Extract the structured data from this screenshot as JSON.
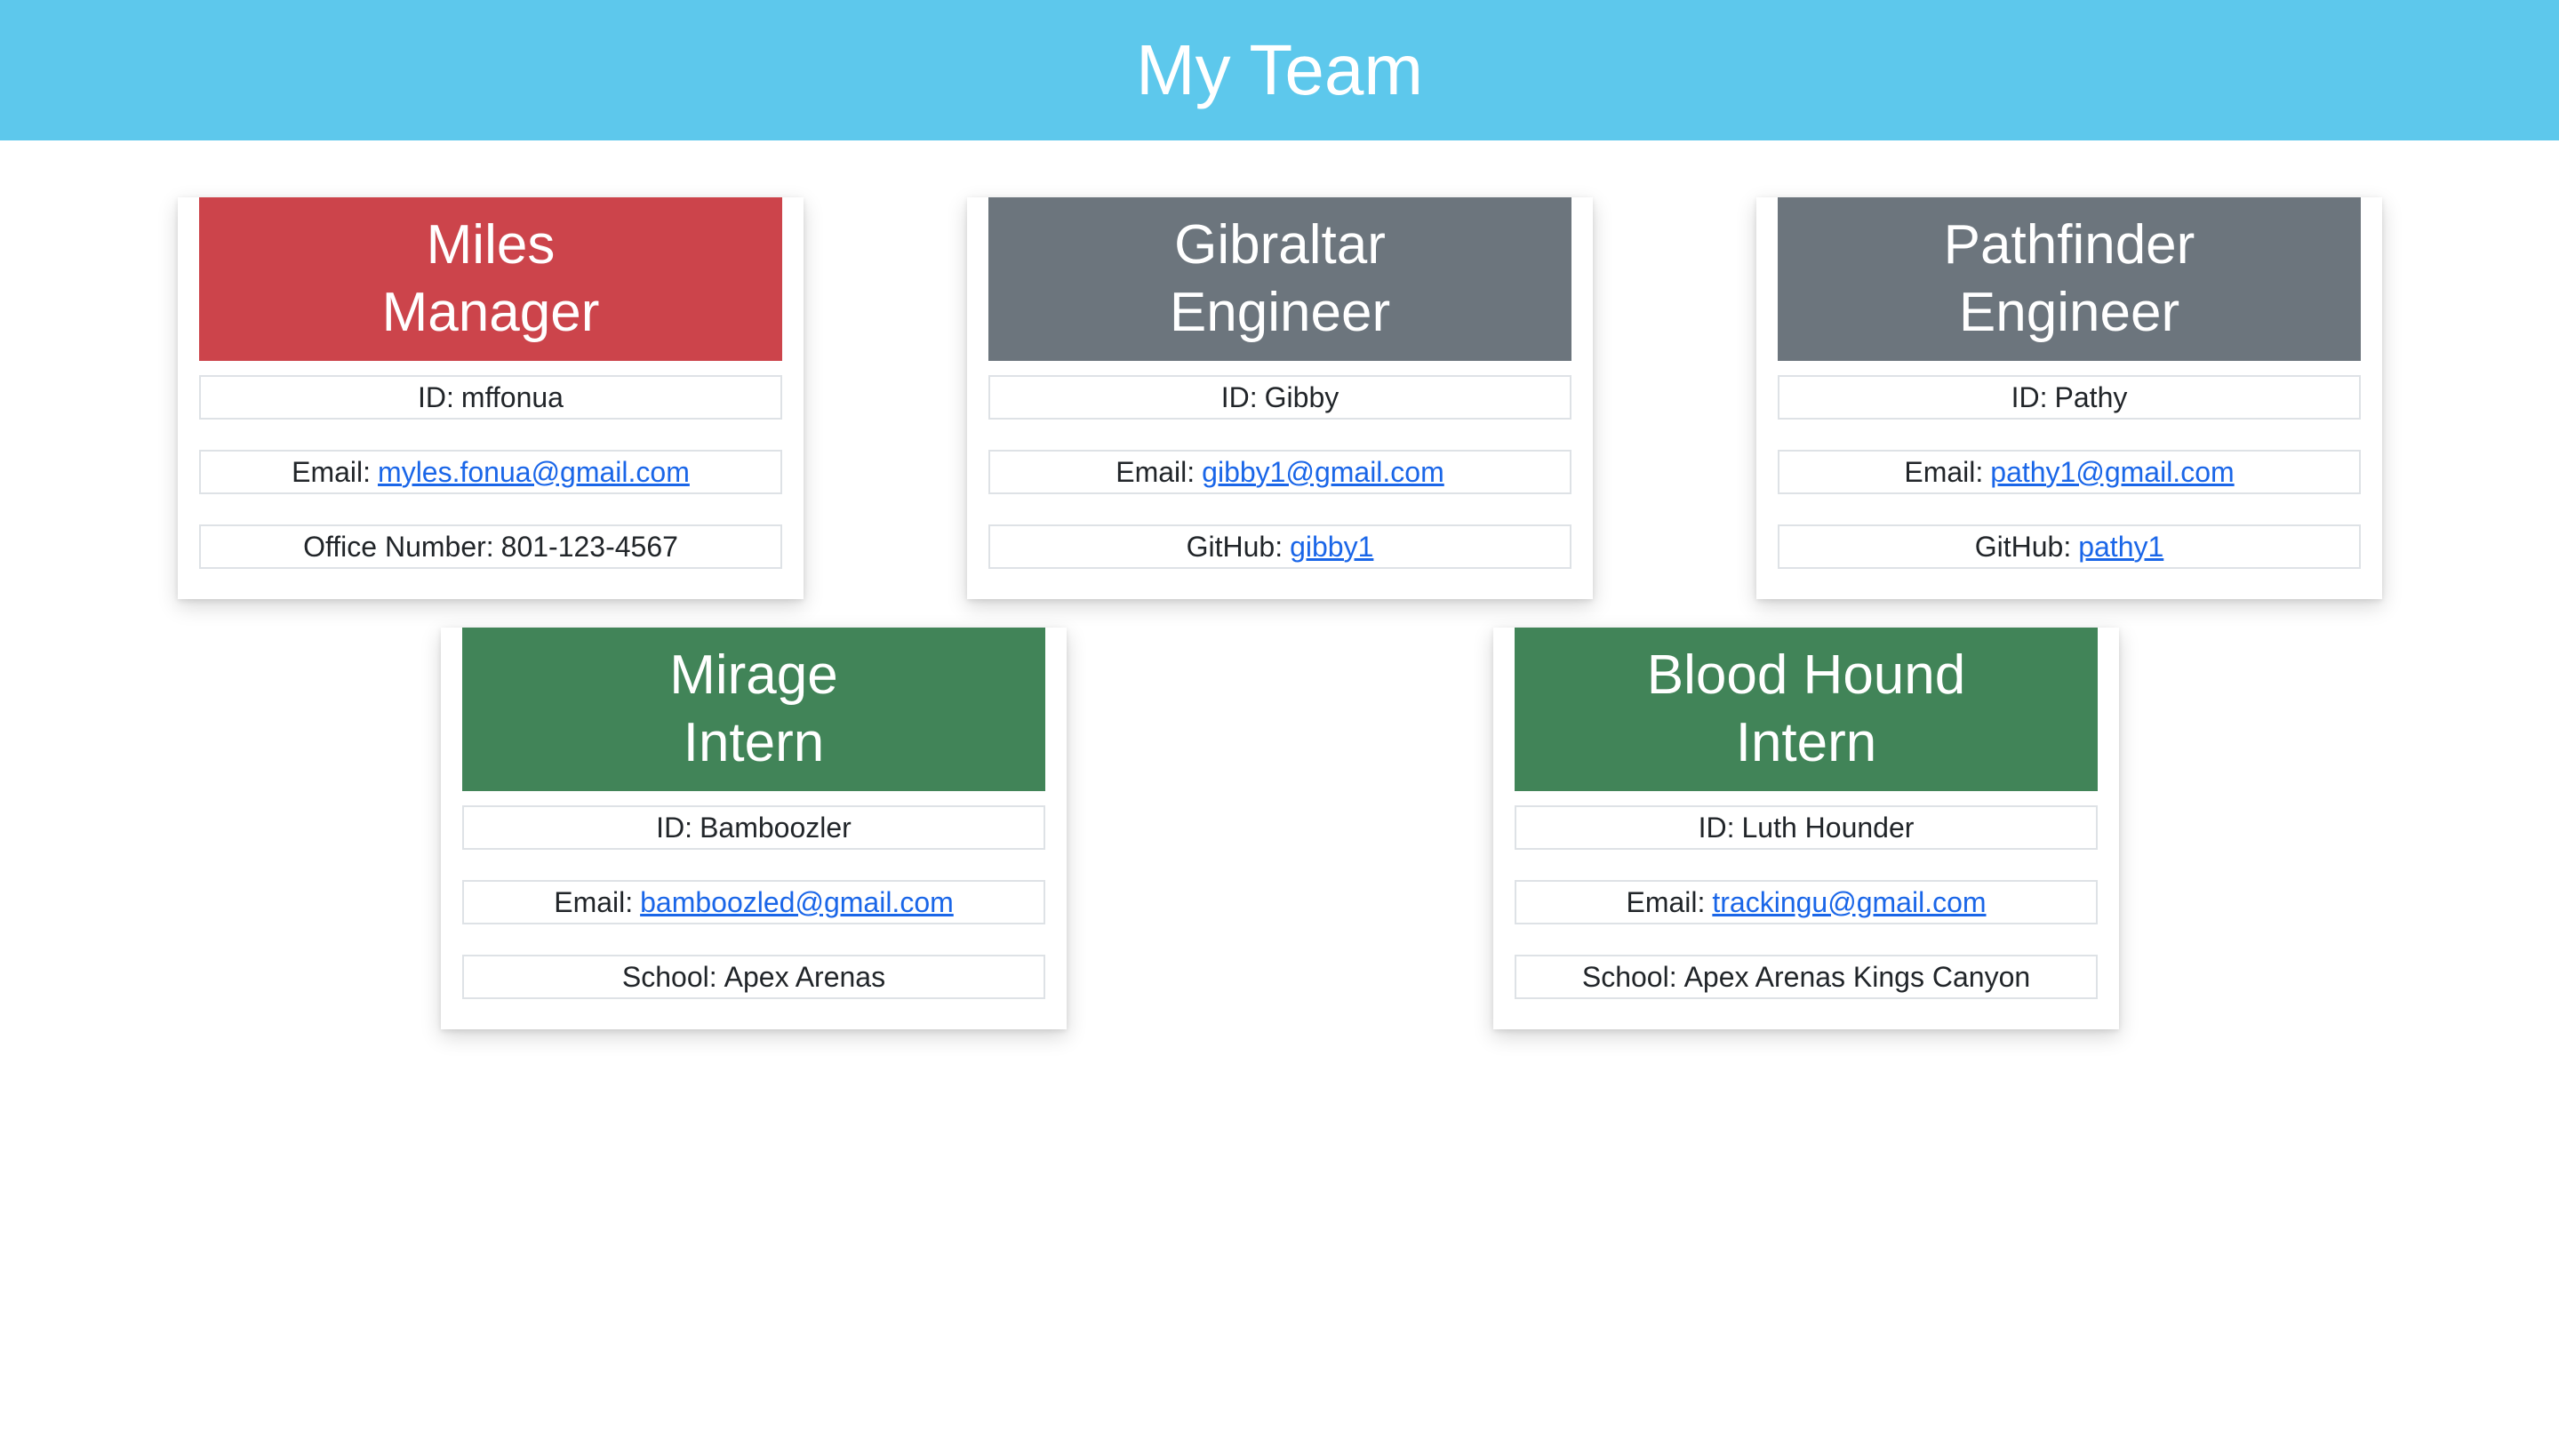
{
  "header": {
    "title": "My Team"
  },
  "colors": {
    "header_bg": "#5dc8ec",
    "manager": "#cc444b",
    "engineer": "#6c757d",
    "intern": "#418458",
    "link": "#1a66e8"
  },
  "cards": [
    {
      "name": "Miles",
      "role": "Manager",
      "id_label": "ID:",
      "id": "mffonua",
      "email_label": "Email:",
      "email": "myles.fonua@gmail.com",
      "extra_label": "Office Number:",
      "extra": "801-123-4567"
    },
    {
      "name": "Gibraltar",
      "role": "Engineer",
      "id_label": "ID:",
      "id": "Gibby",
      "email_label": "Email:",
      "email": "gibby1@gmail.com",
      "extra_label": "GitHub:",
      "extra": "gibby1"
    },
    {
      "name": "Pathfinder",
      "role": "Engineer",
      "id_label": "ID:",
      "id": "Pathy",
      "email_label": "Email:",
      "email": "pathy1@gmail.com",
      "extra_label": "GitHub:",
      "extra": "pathy1"
    },
    {
      "name": "Mirage",
      "role": "Intern",
      "id_label": "ID:",
      "id": "Bamboozler",
      "email_label": "Email:",
      "email": "bamboozled@gmail.com",
      "extra_label": "School:",
      "extra": "Apex Arenas"
    },
    {
      "name": "Blood Hound",
      "role": "Intern",
      "id_label": "ID:",
      "id": "Luth Hounder",
      "email_label": "Email:",
      "email": "trackingu@gmail.com",
      "extra_label": "School:",
      "extra": "Apex Arenas Kings Canyon"
    }
  ]
}
